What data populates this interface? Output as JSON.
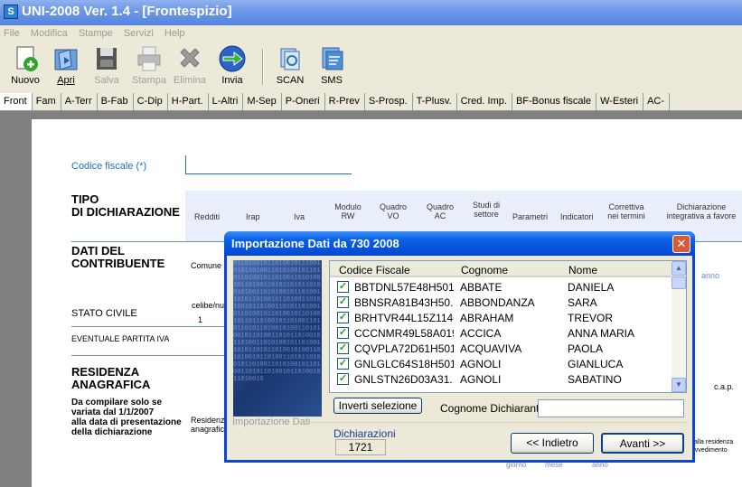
{
  "window": {
    "title": "UNI-2008 Ver. 1.4 - [Frontespizio]"
  },
  "menu": [
    "File",
    "Modifica",
    "Stampe",
    "Servizi",
    "Help"
  ],
  "toolbar": {
    "nuovo": "Nuovo",
    "apri": "Apri",
    "salva": "Salva",
    "stampa": "Stampa",
    "elimina": "Elimina",
    "invia": "Invia",
    "scan": "SCAN",
    "sms": "SMS"
  },
  "tabs": [
    "Front",
    "Fam",
    "A-Terr",
    "B-Fab",
    "C-Dip",
    "H-Part.",
    "L-Altri",
    "M-Sep",
    "P-Oneri",
    "R-Prev",
    "S-Prosp.",
    "T-Plusv.",
    "Cred. Imp.",
    "BF-Bonus fiscale",
    "W-Esteri",
    "AC-"
  ],
  "form": {
    "codice_fiscale_label": "Codice fiscale (*)",
    "tipo": "TIPO\nDI DICHIARAZIONE",
    "headers": [
      "Redditi",
      "Irap",
      "Iva",
      "Modulo RW",
      "Quadro VO",
      "Quadro AC",
      "Studi di settore",
      "Parametri",
      "Indicatori",
      "Correttiva nei termini",
      "Dichiarazione integrativa a favore"
    ],
    "dati": "DATI DEL\nCONTRIBUENTE",
    "comune": "Comune",
    "anno": "anno",
    "stato_civile": "STATO CIVILE",
    "celibe": "celibe/nu",
    "one": "1",
    "partita_iva": "EVENTUALE PARTITA IVA",
    "residenza": "RESIDENZA\nANAGRAFICA",
    "residenza_note": "Da compilare solo se\nvariata dal 1/1/2007\nalla data di presentazione\ndella dichiarazione",
    "residenza_small": "Residenza\nanagrafica",
    "cap": "c.a.p.",
    "giorno": "giorno",
    "mese": "mese",
    "anno2": "anno",
    "domicilio_note": "Se il domicilio\nfiscale è diverso dalla residenza\nanagrafica per provvedimento\namministrativo"
  },
  "dialog": {
    "title": "Importazione Dati da 730 2008",
    "columns": [
      "Codice Fiscale",
      "Cognome",
      "Nome"
    ],
    "rows": [
      {
        "cf": "BBTDNL57E48H501R",
        "cognome": "ABBATE",
        "nome": "DANIELA"
      },
      {
        "cf": "BBNSRA81B43H50...",
        "cognome": "ABBONDANZA",
        "nome": "SARA"
      },
      {
        "cf": "BRHTVR44L15Z114Q",
        "cognome": "ABRAHAM",
        "nome": "TREVOR"
      },
      {
        "cf": "CCCNMR49L58A019Z",
        "cognome": "ACCICA",
        "nome": "ANNA MARIA"
      },
      {
        "cf": "CQVPLA72D61H501Y",
        "cognome": "ACQUAVIVA",
        "nome": "PAOLA"
      },
      {
        "cf": "GNLGLC64S18H501L",
        "cognome": "AGNOLI",
        "nome": "GIANLUCA"
      },
      {
        "cf": "GNLSTN26D03A31...",
        "cognome": "AGNOLI",
        "nome": "SABATINO"
      }
    ],
    "invert_button": "Inverti selezione",
    "cognome_label": "Cognome Dichiarante",
    "cognome_value": "",
    "group_label": "Importazione Dati",
    "dichiarazioni_label": "Dichiarazioni",
    "dichiarazioni_count": "1721",
    "back_button": "<< Indietro",
    "next_button": "Avanti >>"
  }
}
